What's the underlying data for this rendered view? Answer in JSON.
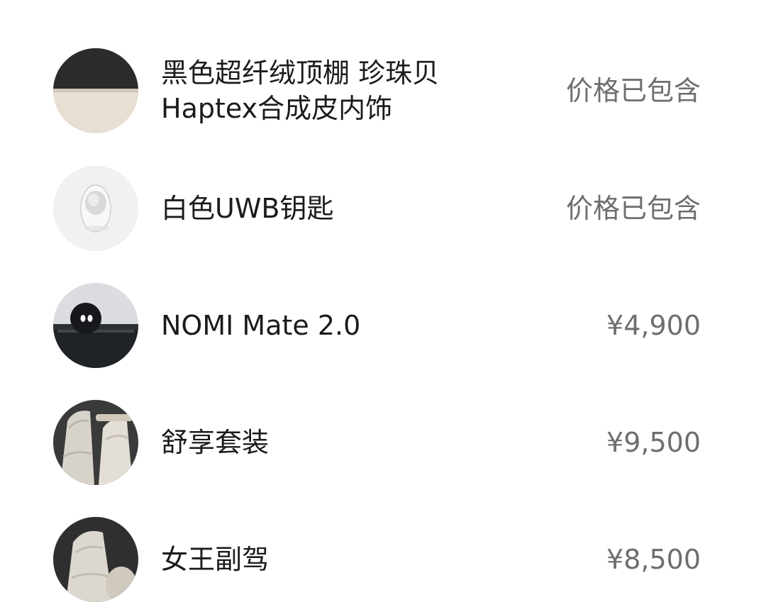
{
  "options": [
    {
      "name_lines": [
        "黑色超纤绒顶棚 珍珠贝",
        "Haptex合成皮内饰"
      ],
      "price": "价格已包含",
      "thumb_icon": "interior-swatch-thumbnail"
    },
    {
      "name_lines": [
        "白色UWB钥匙",
        ""
      ],
      "price": "价格已包含",
      "thumb_icon": "uwb-key-thumbnail"
    },
    {
      "name_lines": [
        "NOMI Mate 2.0",
        ""
      ],
      "price": "¥4,900",
      "thumb_icon": "nomi-mate-thumbnail"
    },
    {
      "name_lines": [
        "舒享套装",
        ""
      ],
      "price": "¥9,500",
      "thumb_icon": "comfort-package-thumbnail"
    },
    {
      "name_lines": [
        "女王副驾",
        ""
      ],
      "price": "¥8,500",
      "thumb_icon": "queen-seat-thumbnail"
    }
  ],
  "colors": {
    "name_text": "#1b1b1b",
    "price_text": "#6e6e6e",
    "background": "#ffffff"
  }
}
